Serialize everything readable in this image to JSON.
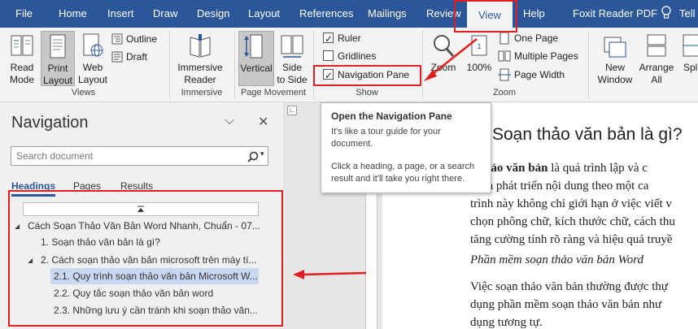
{
  "tabs": [
    "File",
    "Home",
    "Insert",
    "Draw",
    "Design",
    "Layout",
    "References",
    "Mailings",
    "Review",
    "View",
    "Help",
    "Foxit Reader PDF",
    "Tell"
  ],
  "ribbon": {
    "views": {
      "read_mode": [
        "Read",
        "Mode"
      ],
      "print_layout": [
        "Print",
        "Layout"
      ],
      "web_layout": [
        "Web",
        "Layout"
      ],
      "outline": "Outline",
      "draft": "Draft",
      "group_label": "Views"
    },
    "immersive": {
      "reader": [
        "Immersive",
        "Reader"
      ],
      "group_label": "Immersive"
    },
    "page_movement": {
      "vertical": "Vertical",
      "side_to_side": [
        "Side",
        "to Side"
      ],
      "group_label": "Page Movement"
    },
    "show": {
      "ruler": "Ruler",
      "gridlines": "Gridlines",
      "navigation_pane": "Navigation Pane",
      "group_label": "Show"
    },
    "zoom": {
      "zoom": "Zoom",
      "hundred": "100%",
      "one_page": "One Page",
      "multiple_pages": "Multiple Pages",
      "page_width": "Page Width",
      "group_label": "Zoom"
    },
    "window": {
      "new_window": [
        "New",
        "Window"
      ],
      "arrange_all": [
        "Arrange",
        "All"
      ],
      "split": "Spl"
    }
  },
  "tooltip": {
    "title": "Open the Navigation Pane",
    "text1": [
      "It's like a tour guide for your",
      "document."
    ],
    "text2": [
      "Click a heading, a page, or a search",
      "result and it'll take you right there."
    ]
  },
  "nav": {
    "title": "Navigation",
    "search_placeholder": "Search document",
    "tabs": [
      "Headings",
      "Pages",
      "Results"
    ],
    "tree": [
      "Cách Soạn Thảo Văn Bản Word Nhanh, Chuẩn - 07...",
      "1. Soạn thảo văn bản là gì?",
      "2. Cách soạn thảo văn bản microsoft trên máy tí...",
      "2.1. Quy trình soạn thảo văn bản Microsoft W...",
      "2.2. Quy tắc soạn thảo văn bản word",
      "2.3. Những lưu ý cần tránh khi soạn thảo văn..."
    ]
  },
  "document": {
    "heading": "Soạn thảo văn bản là gì?",
    "p1_bold": "n thảo văn bản",
    "p1_rest": " là quá trình lập và c",
    "lines": [
      "y, và phát triển nội dung theo một ca",
      "trình này không chỉ giới hạn ở việc viết v",
      "chọn phông chữ, kích thước chữ, cách thu",
      "tăng cường tính rõ ràng và hiệu quả truyề"
    ],
    "italic_line": "Phần mềm soạn thảo văn bản Word",
    "p3": [
      "Việc soạn thảo văn bản thường được thự",
      "dụng phần mềm soạn thảo văn bản như",
      "dụng tương tự."
    ]
  },
  "colors": {
    "accent": "#2b579a",
    "annotation_red": "#e02020"
  }
}
